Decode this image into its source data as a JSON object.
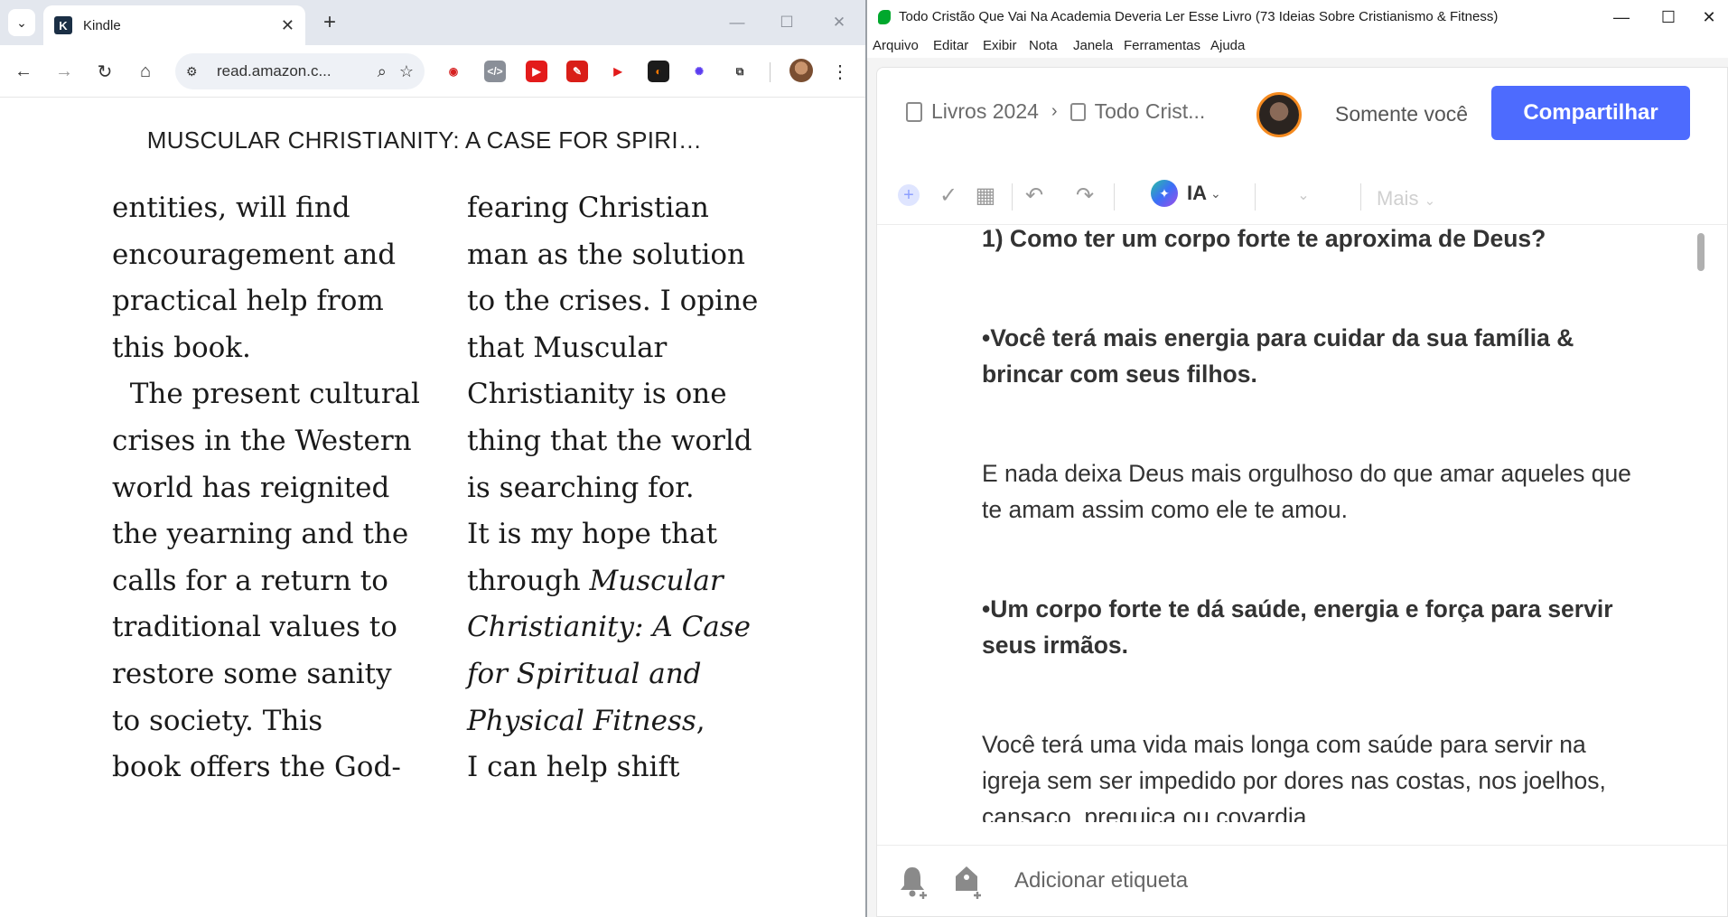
{
  "chrome": {
    "tab_title": "Kindle",
    "tab_close_glyph": "✕",
    "new_tab_glyph": "+",
    "url": "read.amazon.c...",
    "tab_search_glyph": "⌄",
    "controls": {
      "minimize": "—",
      "maximize": "☐",
      "close": "✕"
    },
    "nav": {
      "back": "←",
      "forward": "→",
      "reload": "↻",
      "home": "⌂"
    },
    "omnibox_icons": {
      "tune": "⚙",
      "zoom": "⌕",
      "star": "☆"
    },
    "menu_glyph": "⋮",
    "extensions": [
      {
        "name": "record-extension-icon",
        "bg": "#ffffff",
        "fg": "#d62020",
        "glyph": "◉"
      },
      {
        "name": "code-extension-icon",
        "bg": "#8a8f98",
        "fg": "#ffffff",
        "glyph": "</>"
      },
      {
        "name": "youtube-extension-icon",
        "bg": "#e31b1b",
        "fg": "#ffffff",
        "glyph": "▶"
      },
      {
        "name": "red-extension-icon",
        "bg": "#d91e18",
        "fg": "#ffffff",
        "glyph": "✎"
      },
      {
        "name": "play-extension-icon",
        "bg": "#ffffff",
        "fg": "#e31b1b",
        "glyph": "▶"
      },
      {
        "name": "orange-extension-icon",
        "bg": "#1b1b1b",
        "fg": "#ff7a00",
        "glyph": "◐"
      },
      {
        "name": "spark-extension-icon",
        "bg": "#ffffff",
        "fg": "#5b3cf0",
        "glyph": "✺"
      },
      {
        "name": "puzzle-extension-icon",
        "bg": "#ffffff",
        "fg": "#333333",
        "glyph": "⧉"
      }
    ]
  },
  "book": {
    "header": "MUSCULAR CHRISTIANITY: A CASE FOR SPIRI…",
    "left_lines": [
      {
        "t": "entities, will find",
        "i": false
      },
      {
        "t": "encouragement and",
        "i": false
      },
      {
        "t": "practical help from",
        "i": false
      },
      {
        "t": "this book.",
        "i": false
      },
      {
        "t": "  The present cultural",
        "i": false
      },
      {
        "t": "crises in the Western",
        "i": false
      },
      {
        "t": "world has reignited",
        "i": false
      },
      {
        "t": "the yearning and the",
        "i": false
      },
      {
        "t": "calls for a return to",
        "i": false
      },
      {
        "t": "traditional values to",
        "i": false
      },
      {
        "t": "restore some sanity",
        "i": false
      },
      {
        "t": "to society. This",
        "i": false
      },
      {
        "t": "book offers the God-",
        "i": false
      }
    ],
    "right_lines": [
      {
        "t": "fearing Christian",
        "i": false
      },
      {
        "t": "man as the solution",
        "i": false
      },
      {
        "t": "to the crises. I opine",
        "i": false
      },
      {
        "t": "that Muscular",
        "i": false
      },
      {
        "t": "Christianity is one",
        "i": false
      },
      {
        "t": "thing that the world",
        "i": false
      },
      {
        "t": "is searching for.",
        "i": false
      },
      {
        "t": "It is my hope that",
        "i": false
      },
      {
        "t": "through ",
        "i": false,
        "tail": "Muscular"
      },
      {
        "t": "Christianity: A Case",
        "i": true
      },
      {
        "t": "for Spiritual and",
        "i": true
      },
      {
        "t": "Physical Fitness",
        "i": true,
        "tail_plain": ","
      },
      {
        "t": "I can help shift",
        "i": false
      }
    ]
  },
  "evernote": {
    "window_title": "Todo Cristão Que Vai Na Academia Deveria Ler Esse Livro (73 Ideias Sobre Cristianismo & Fitness)",
    "controls": {
      "minimize": "—",
      "maximize": "☐",
      "close": "✕"
    },
    "menu": [
      "Arquivo",
      "Editar",
      "Exibir",
      "Nota",
      "Janela",
      "Ferramentas",
      "Ajuda"
    ],
    "breadcrumb": {
      "notebook": "Livros 2024",
      "note": "Todo Crist...",
      "chevron": "›"
    },
    "share_who": "Somente você",
    "share_button": "Compartilhar",
    "toolbar": {
      "add": "+",
      "check": "✓",
      "calendar": "▦",
      "undo": "↶",
      "redo": "↷",
      "ai_glyph": "✦",
      "ai_label": "IA",
      "caret": "⌄",
      "more": "Mais"
    },
    "note_paragraphs": [
      {
        "text": "1) Como ter um corpo forte te aproxima de Deus?",
        "bold": true
      },
      {
        "text": "•Você terá mais energia para cuidar da sua família & brincar com seus filhos.",
        "bold": true
      },
      {
        "text": "E nada deixa Deus mais orgulhoso do que amar aqueles que te amam assim como ele te amou.",
        "bold": false
      },
      {
        "text": "•Um corpo forte te dá saúde, energia e força para servir seus irmãos.",
        "bold": true
      },
      {
        "text": "Você terá uma vida mais longa com saúde para servir na igreja sem ser impedido por dores nas costas, nos joelhos, cansaço, preguiça ou covardia.",
        "bold": false
      }
    ],
    "footer": {
      "tag_placeholder": "Adicionar etiqueta"
    },
    "colors": {
      "accent": "#4d6bfe",
      "evernote_green": "#00a82d",
      "avatar_ring": "#f58a1f"
    }
  }
}
